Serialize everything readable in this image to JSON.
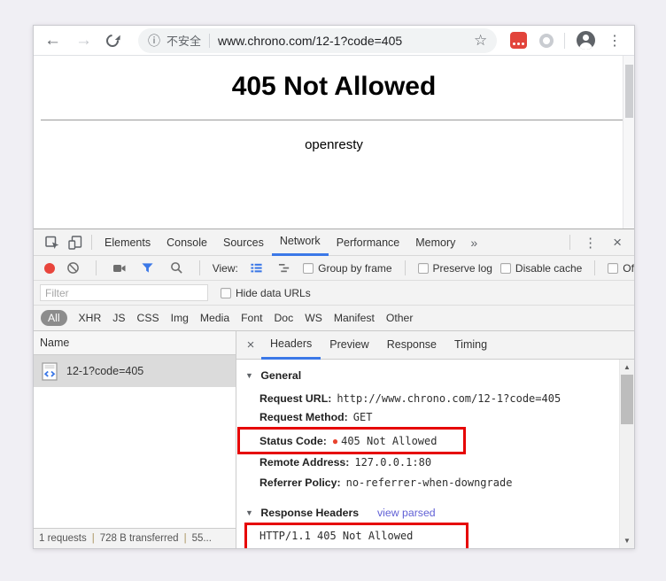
{
  "browser": {
    "security_label": "不安全",
    "url": "www.chrono.com/12-1?code=405"
  },
  "page": {
    "title": "405 Not Allowed",
    "server": "openresty"
  },
  "devtools": {
    "tabs": [
      "Elements",
      "Console",
      "Sources",
      "Network",
      "Performance",
      "Memory"
    ],
    "active_tab": "Network",
    "toolbar": {
      "view_label": "View:",
      "checkboxes": [
        "Group by frame",
        "Preserve log",
        "Disable cache",
        "Of"
      ]
    },
    "filter": {
      "placeholder": "Filter",
      "hide_data_urls_label": "Hide data URLs"
    },
    "type_filters": [
      "All",
      "XHR",
      "JS",
      "CSS",
      "Img",
      "Media",
      "Font",
      "Doc",
      "WS",
      "Manifest",
      "Other"
    ],
    "selected_type_filter": "All",
    "network_table": {
      "name_header": "Name",
      "request_name": "12-1?code=405"
    },
    "summary": {
      "requests": "1 requests",
      "transferred": "728 B transferred",
      "more": "55...",
      "separator": "|"
    },
    "details": {
      "tabs": [
        "Headers",
        "Preview",
        "Response",
        "Timing"
      ],
      "active_tab": "Headers",
      "general": {
        "title": "General",
        "rows": [
          {
            "key": "Request URL:",
            "value": "http://www.chrono.com/12-1?code=405"
          },
          {
            "key": "Request Method:",
            "value": "GET"
          },
          {
            "key": "Status Code:",
            "value": "405 Not Allowed"
          },
          {
            "key": "Remote Address:",
            "value": "127.0.0.1:80"
          },
          {
            "key": "Referrer Policy:",
            "value": "no-referrer-when-downgrade"
          }
        ]
      },
      "response_headers": {
        "title": "Response Headers",
        "link": "view parsed",
        "first_line": "HTTP/1.1 405 Not Allowed"
      }
    }
  },
  "icons": {
    "back": "←",
    "forward": "→",
    "info": "ⓘ",
    "star": "☆",
    "kebab": "⋮",
    "more_tabs": "»",
    "close": "×",
    "section_triangle": "▼",
    "status_dot": "●",
    "scroll_up": "▲",
    "scroll_down": "▼"
  },
  "colors": {
    "accent_blue": "#3b78e7",
    "annotation_red": "#e60404",
    "record_red": "#e8453c",
    "status_dot_red": "#e8442f",
    "selected_row_gray": "#dbdbdb"
  }
}
